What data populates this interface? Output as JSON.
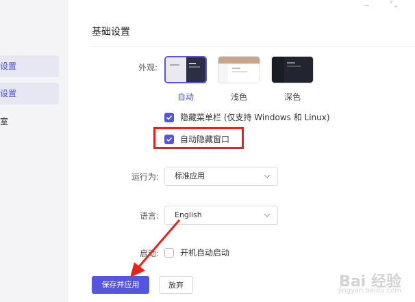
{
  "sidebar": {
    "items": [
      {
        "label": "设置",
        "active": true
      },
      {
        "label": "设置",
        "active": true
      },
      {
        "label": "室",
        "active": false
      }
    ]
  },
  "section": {
    "title": "基础设置"
  },
  "appearance": {
    "label": "外观:",
    "options": [
      {
        "label": "自动",
        "selected": true
      },
      {
        "label": "浅色",
        "selected": false
      },
      {
        "label": "深色",
        "selected": false
      }
    ]
  },
  "options": {
    "hide_menu_bar": {
      "label": "隐藏菜单栏 (仅支持 Windows 和 Linux)",
      "checked": true
    },
    "auto_hide_window": {
      "label": "自动隐藏窗口",
      "checked": true
    }
  },
  "run_as": {
    "label": "运行为:",
    "value": "标准应用"
  },
  "language": {
    "label": "语言:",
    "value": "English"
  },
  "startup": {
    "label": "启动:",
    "option": {
      "label": "开机自动启动",
      "checked": false
    }
  },
  "buttons": {
    "save": "保存并应用",
    "discard": "放弃"
  },
  "watermark": {
    "brand": "Bai 经验",
    "sub": "jingyan.baidu.com"
  },
  "colors": {
    "accent": "#5455e0",
    "annotation": "#e8211d"
  }
}
